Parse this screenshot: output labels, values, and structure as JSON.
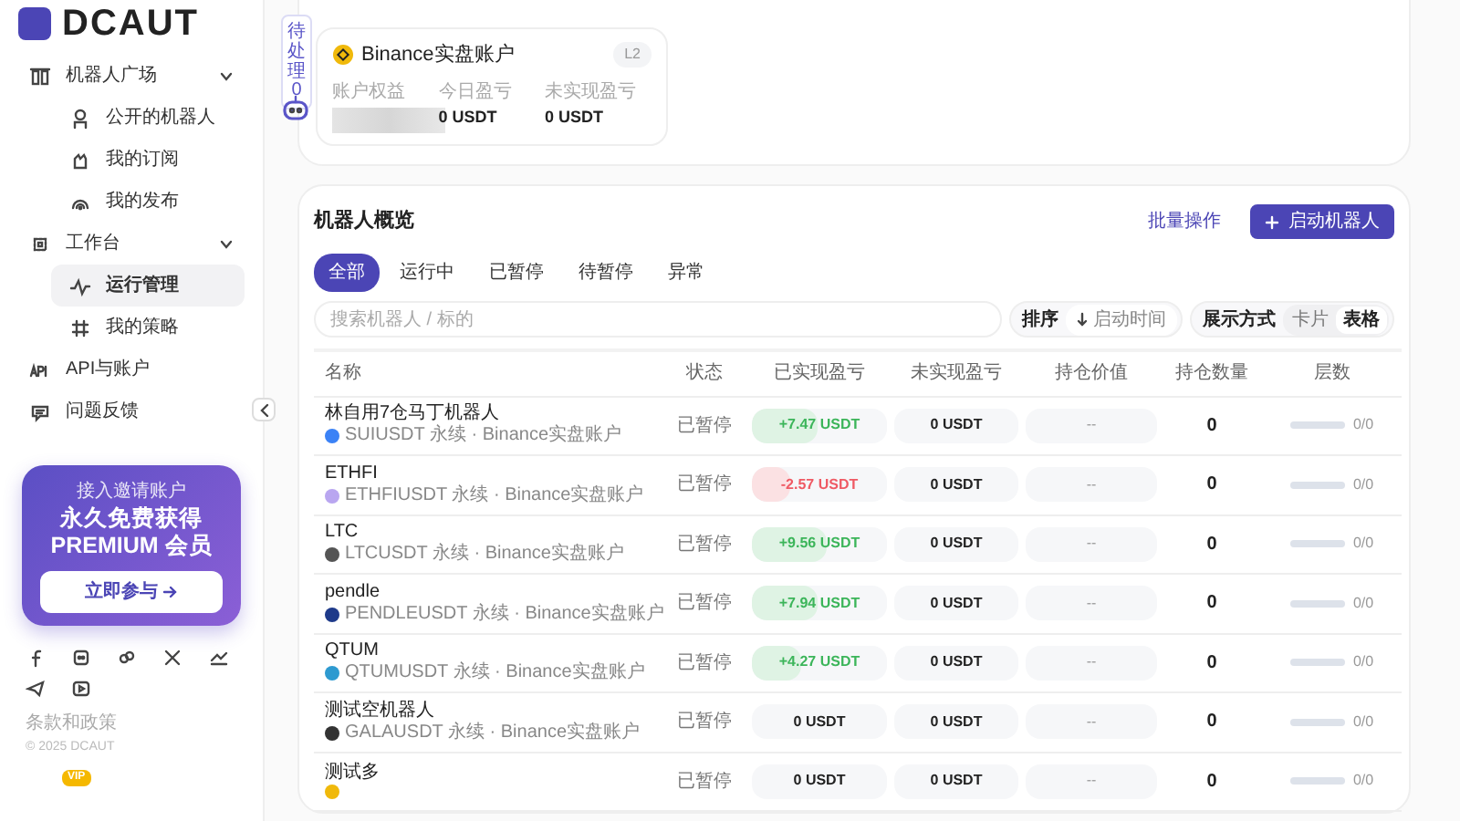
{
  "logo": {
    "text": "DCAUT"
  },
  "sidebar": {
    "items": [
      {
        "label": "机器人广场",
        "expanded": true,
        "selected": false,
        "children": [
          {
            "label": "公开的机器人",
            "selected": false
          },
          {
            "label": "我的订阅",
            "selected": false
          },
          {
            "label": "我的发布",
            "selected": false
          }
        ]
      },
      {
        "label": "工作台",
        "expanded": true,
        "selected": false,
        "children": [
          {
            "label": "运行管理",
            "selected": true
          },
          {
            "label": "我的策略",
            "selected": false
          }
        ]
      },
      {
        "label": "API与账户",
        "selected": false
      },
      {
        "label": "问题反馈",
        "selected": false
      }
    ]
  },
  "promo": {
    "subtitle": "接入邀请账户",
    "title_lines": [
      "永久免费获得",
      "PREMIUM 会员"
    ],
    "button": "立即参与"
  },
  "footer": {
    "terms": "条款和政策",
    "copyright": "© 2025 DCAUT",
    "vip_badge": "VIP"
  },
  "pending": {
    "label": "待处理",
    "count": "0"
  },
  "account_overview": {
    "account": {
      "name": "Binance实盘账户",
      "tier": "L2",
      "metrics": [
        {
          "label": "账户权益",
          "kind": "hidden"
        },
        {
          "label": "今日盈亏",
          "kind": "text",
          "value": "0 USDT"
        },
        {
          "label": "未实现盈亏",
          "kind": "text",
          "value": "0 USDT"
        }
      ]
    }
  },
  "robots": {
    "title": "机器人概览",
    "batch_button": "批量操作",
    "start_button": "启动机器人",
    "filters": [
      {
        "label": "全部",
        "selected": true
      },
      {
        "label": "运行中",
        "selected": false
      },
      {
        "label": "已暂停",
        "selected": false
      },
      {
        "label": "待暂停",
        "selected": false
      },
      {
        "label": "异常",
        "selected": false
      }
    ],
    "search": {
      "placeholder": "搜索机器人 / 标的"
    },
    "sort": {
      "label": "排序",
      "value": "启动时间"
    },
    "view": {
      "label": "展示方式",
      "options": [
        {
          "label": "卡片",
          "selected": false
        },
        {
          "label": "表格",
          "selected": true
        }
      ]
    },
    "table": {
      "columns": [
        "名称",
        "状态",
        "已实现盈亏",
        "未实现盈亏",
        "持仓价值",
        "持仓数量",
        "层数"
      ],
      "rows": [
        {
          "name": "林自用7仓马丁机器人",
          "symbol_line": "SUIUSDT 永续 · Binance实盘账户",
          "color": "#3b82f6",
          "status": "已暂停",
          "realized": {
            "text": "+7.47 USDT",
            "kind": "profit",
            "level": 0.48
          },
          "unrealized": "0 USDT",
          "position_value": "--",
          "position_qty": "0",
          "layers": {
            "text": "0/0",
            "level": 0
          }
        },
        {
          "name": "ETHFI",
          "symbol_line": "ETHFIUSDT 永续 · Binance实盘账户",
          "color": "#b9a6f0",
          "status": "已暂停",
          "realized": {
            "text": "-2.57 USDT",
            "kind": "loss",
            "level": 0.28
          },
          "unrealized": "0 USDT",
          "position_value": "--",
          "position_qty": "0",
          "layers": {
            "text": "0/0",
            "level": 0
          }
        },
        {
          "name": "LTC",
          "symbol_line": "LTCUSDT 永续 · Binance实盘账户",
          "color": "#555555",
          "status": "已暂停",
          "realized": {
            "text": "+9.56 USDT",
            "kind": "profit",
            "level": 0.55
          },
          "unrealized": "0 USDT",
          "position_value": "--",
          "position_qty": "0",
          "layers": {
            "text": "0/0",
            "level": 0
          }
        },
        {
          "name": "pendle",
          "symbol_line": "PENDLEUSDT 永续 · Binance实盘账户",
          "color": "#1e3a8a",
          "status": "已暂停",
          "realized": {
            "text": "+7.94 USDT",
            "kind": "profit",
            "level": 0.48
          },
          "unrealized": "0 USDT",
          "position_value": "--",
          "position_qty": "0",
          "layers": {
            "text": "0/0",
            "level": 0
          }
        },
        {
          "name": "QTUM",
          "symbol_line": "QTUMUSDT 永续 · Binance实盘账户",
          "color": "#2e9ad0",
          "status": "已暂停",
          "realized": {
            "text": "+4.27 USDT",
            "kind": "profit",
            "level": 0.37
          },
          "unrealized": "0 USDT",
          "position_value": "--",
          "position_qty": "0",
          "layers": {
            "text": "0/0",
            "level": 0
          }
        },
        {
          "name": "测试空机器人",
          "symbol_line": "GALAUSDT 永续 · Binance实盘账户",
          "color": "#333333",
          "status": "已暂停",
          "realized": {
            "text": "0 USDT",
            "kind": "zero",
            "level": 0
          },
          "unrealized": "0 USDT",
          "position_value": "--",
          "position_qty": "0",
          "layers": {
            "text": "0/0",
            "level": 0
          }
        },
        {
          "name": "测试多",
          "color": "#f0b90b",
          "status": "已暂停",
          "realized": {
            "text": "0 USDT",
            "kind": "zero",
            "level": 0
          },
          "unrealized": "0 USDT",
          "position_value": "--",
          "position_qty": "0",
          "layers": {
            "text": "0/0",
            "level": 0
          }
        }
      ]
    }
  }
}
